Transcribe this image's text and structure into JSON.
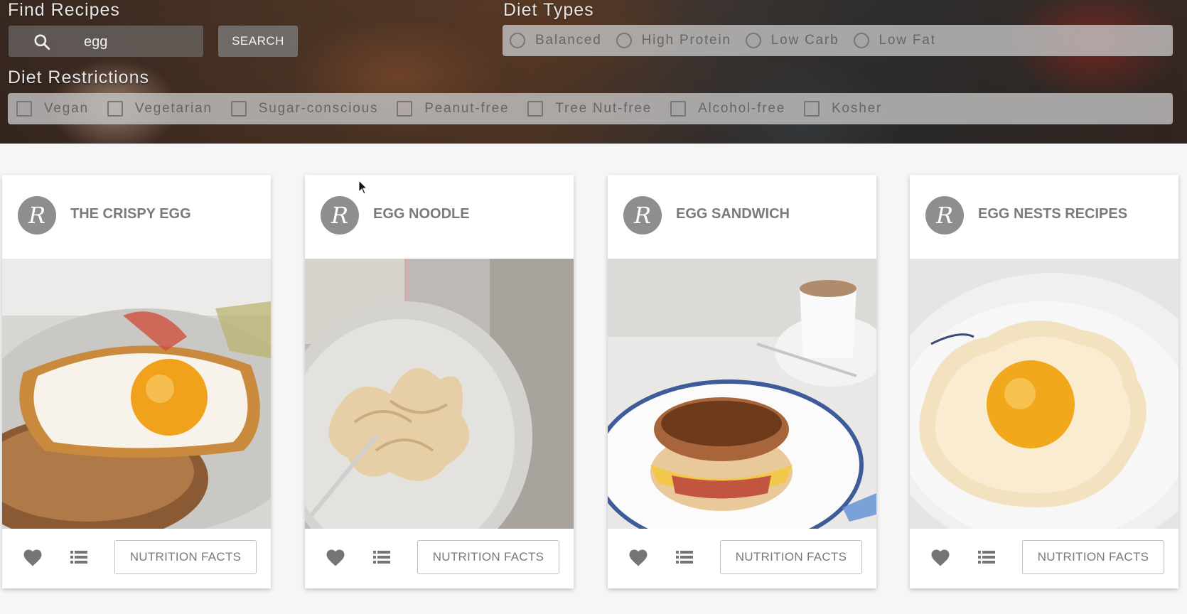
{
  "search": {
    "heading": "Find Recipes",
    "query": "egg",
    "button_label": "SEARCH",
    "icon": "search-icon"
  },
  "diet_types": {
    "heading": "Diet Types",
    "options": [
      "Balanced",
      "High Protein",
      "Low Carb",
      "Low Fat"
    ]
  },
  "diet_restrictions": {
    "heading": "Diet Restrictions",
    "options": [
      "Vegan",
      "Vegetarian",
      "Sugar-conscious",
      "Peanut-free",
      "Tree Nut-free",
      "Alcohol-free",
      "Kosher"
    ]
  },
  "recipes": [
    {
      "avatar": "R",
      "title": "THE CRISPY EGG",
      "button": "NUTRITION FACTS"
    },
    {
      "avatar": "R",
      "title": "EGG NOODLE",
      "button": "NUTRITION FACTS"
    },
    {
      "avatar": "R",
      "title": "EGG SANDWICH",
      "button": "NUTRITION FACTS"
    },
    {
      "avatar": "R",
      "title": "EGG NESTS RECIPES",
      "button": "NUTRITION FACTS"
    }
  ],
  "colors": {
    "card_title": "#7a7a7a",
    "avatar_bg": "#8e8e8e",
    "icon_gray": "#757575",
    "panel_bg": "#c4c4c4"
  }
}
